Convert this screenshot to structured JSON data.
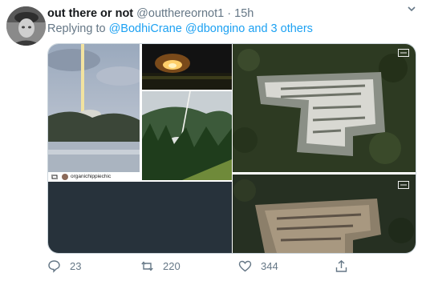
{
  "user": {
    "name": "out there or not",
    "handle": "@outthereornot1",
    "separator": "·",
    "time": "15h"
  },
  "reply": {
    "prefix": "Replying to",
    "mentions": "@BodhiCrane @dbongino and 3 others"
  },
  "media": {
    "gif_credit": "organichippiechic"
  },
  "actions": {
    "replies": "23",
    "retweets": "220",
    "likes": "344"
  },
  "icons": {
    "menu": "chevron-down-icon",
    "reply": "comment-icon",
    "retweet": "retweet-icon",
    "like": "heart-icon",
    "share": "share-icon",
    "retweet_small": "retweet-icon"
  },
  "colors": {
    "link": "#1da1f2",
    "secondary": "#657786",
    "border": "#ccd6dd"
  }
}
